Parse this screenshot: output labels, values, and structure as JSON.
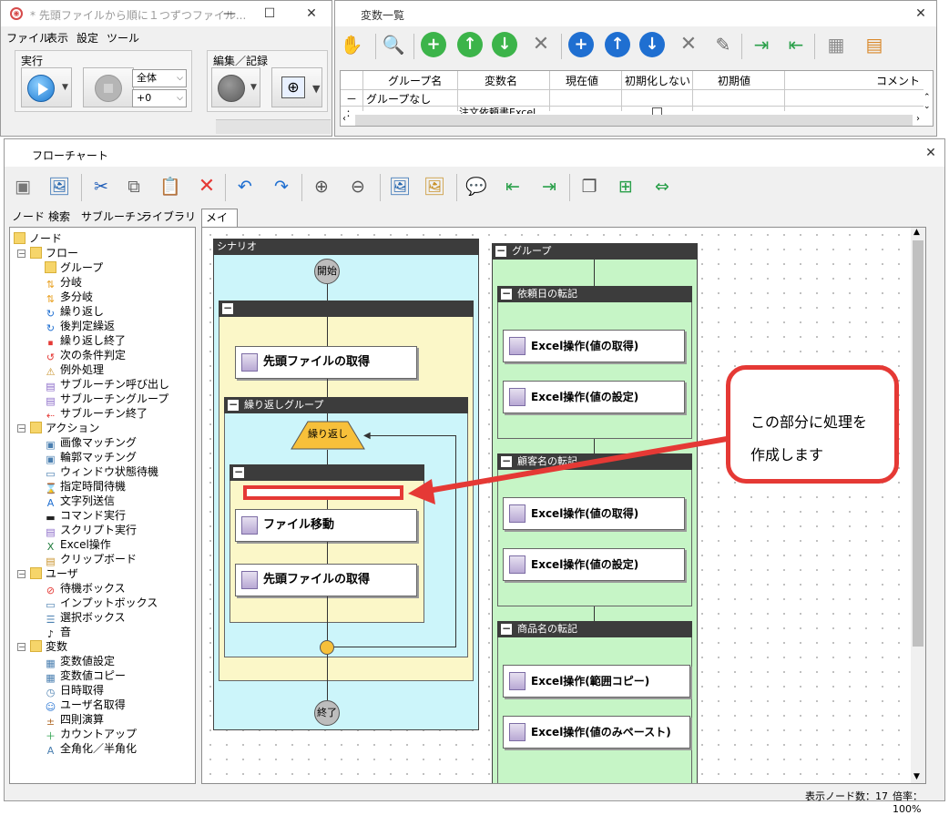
{
  "main_window": {
    "title": "* 先頭ファイルから順に１つずつファイル...",
    "menu": [
      "ファイル",
      "表示",
      "設定",
      "ツール"
    ],
    "run_group_label": "実行",
    "edit_group_label": "編集／記録",
    "scope_select": "全体",
    "offset_select": "+0"
  },
  "variable_window": {
    "title": "変数一覧",
    "columns": [
      "グループ名",
      "変数名",
      "現在値",
      "初期化しない",
      "初期値",
      "コメント"
    ],
    "rows": [
      {
        "marker": "－",
        "group": "グループなし"
      },
      {
        "marker": "：",
        "var": "注文依頼書Excel"
      }
    ]
  },
  "flow_window": {
    "title": "フローチャート",
    "left_tabs": [
      "ノード",
      "検索",
      "サブルーチン",
      "ライブラリ"
    ],
    "main_tab": "メイン",
    "tree": [
      {
        "label": "ノード",
        "level": 0,
        "type": "folder"
      },
      {
        "label": "フロー",
        "level": 1,
        "type": "folder",
        "expander": "－"
      },
      {
        "label": "グループ",
        "level": 2,
        "type": "group"
      },
      {
        "label": "分岐",
        "level": 2,
        "type": "branch"
      },
      {
        "label": "多分岐",
        "level": 2,
        "type": "branch"
      },
      {
        "label": "繰り返し",
        "level": 2,
        "type": "loop"
      },
      {
        "label": "後判定繰返",
        "level": 2,
        "type": "loop"
      },
      {
        "label": "繰り返し終了",
        "level": 2,
        "type": "loop-end"
      },
      {
        "label": "次の条件判定",
        "level": 2,
        "type": "next"
      },
      {
        "label": "例外処理",
        "level": 2,
        "type": "exception"
      },
      {
        "label": "サブルーチン呼び出し",
        "level": 2,
        "type": "sub"
      },
      {
        "label": "サブルーチングループ",
        "level": 2,
        "type": "sub"
      },
      {
        "label": "サブルーチン終了",
        "level": 2,
        "type": "sub-end"
      },
      {
        "label": "アクション",
        "level": 1,
        "type": "folder",
        "expander": "－"
      },
      {
        "label": "画像マッチング",
        "level": 2,
        "type": "image"
      },
      {
        "label": "輪郭マッチング",
        "level": 2,
        "type": "image"
      },
      {
        "label": "ウィンドウ状態待機",
        "level": 2,
        "type": "window"
      },
      {
        "label": "指定時間待機",
        "level": 2,
        "type": "timer"
      },
      {
        "label": "文字列送信",
        "level": 2,
        "type": "text"
      },
      {
        "label": "コマンド実行",
        "level": 2,
        "type": "cmd"
      },
      {
        "label": "スクリプト実行",
        "level": 2,
        "type": "script"
      },
      {
        "label": "Excel操作",
        "level": 2,
        "type": "excel"
      },
      {
        "label": "クリップボード",
        "level": 2,
        "type": "clipboard"
      },
      {
        "label": "ユーザ",
        "level": 1,
        "type": "folder",
        "expander": "－"
      },
      {
        "label": "待機ボックス",
        "level": 2,
        "type": "wait"
      },
      {
        "label": "インプットボックス",
        "level": 2,
        "type": "input"
      },
      {
        "label": "選択ボックス",
        "level": 2,
        "type": "select"
      },
      {
        "label": "音",
        "level": 2,
        "type": "sound"
      },
      {
        "label": "変数",
        "level": 1,
        "type": "folder",
        "expander": "－"
      },
      {
        "label": "変数値設定",
        "level": 2,
        "type": "var"
      },
      {
        "label": "変数値コピー",
        "level": 2,
        "type": "var"
      },
      {
        "label": "日時取得",
        "level": 2,
        "type": "clock"
      },
      {
        "label": "ユーザ名取得",
        "level": 2,
        "type": "user"
      },
      {
        "label": "四則演算",
        "level": 2,
        "type": "calc"
      },
      {
        "label": "カウントアップ",
        "level": 2,
        "type": "count"
      },
      {
        "label": "全角化／半角化",
        "level": 2,
        "type": "width"
      }
    ],
    "scenario": {
      "title": "シナリオ",
      "start": "開始",
      "end": "終了",
      "first_action": "先頭ファイルの取得",
      "loop_group_title": "繰り返しグループ",
      "loop_label": "繰り返し",
      "move_action": "ファイル移動",
      "repeat_action": "先頭ファイルの取得"
    },
    "group_panel": {
      "title": "グループ",
      "sections": [
        {
          "title": "依頼日の転記",
          "actions": [
            "Excel操作(値の取得)",
            "Excel操作(値の設定)"
          ]
        },
        {
          "title": "顧客名の転記",
          "actions": [
            "Excel操作(値の取得)",
            "Excel操作(値の設定)"
          ]
        },
        {
          "title": "商品名の転記",
          "actions": [
            "Excel操作(範囲コピー)",
            "Excel操作(値のみペースト)"
          ]
        }
      ]
    },
    "callout": {
      "line1": "この部分に処理を",
      "line2": "作成します"
    },
    "status": {
      "nodes": "表示ノード数：17",
      "zoom": "倍率：100%"
    }
  },
  "colors": {
    "accent_red": "#e53935",
    "scenario_bg": "#ccf5fa",
    "group_bg": "#c6f5c6",
    "loop_bg": "#fbf7c8",
    "loop_diamond": "#f7c03a"
  }
}
